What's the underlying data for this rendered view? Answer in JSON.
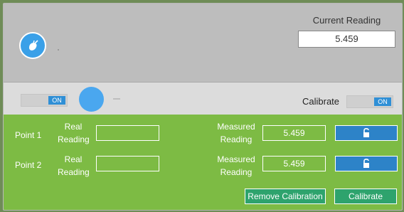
{
  "current_reading": {
    "label": "Current Reading",
    "value": "5.459"
  },
  "toggles": {
    "left_state": "ON",
    "calibrate_label": "Calibrate",
    "calibrate_state": "ON"
  },
  "points": [
    {
      "label": "Point 1",
      "real_label_1": "Real",
      "real_label_2": "Reading",
      "real_value": "",
      "measured_label_1": "Measured",
      "measured_label_2": "Reading",
      "measured_value": "5.459"
    },
    {
      "label": "Point 2",
      "real_label_1": "Real",
      "real_label_2": "Reading",
      "real_value": "",
      "measured_label_1": "Measured",
      "measured_label_2": "Reading",
      "measured_value": "5.459"
    }
  ],
  "actions": {
    "remove_calibration": "Remove Calibration",
    "calibrate": "Calibrate"
  },
  "icons": {
    "logo": "fruit-logo-icon",
    "lock": "unlock-icon"
  },
  "colors": {
    "accent_blue": "#2d83c8",
    "green_panel": "#7dbb44",
    "teal_button": "#2ea36d"
  }
}
